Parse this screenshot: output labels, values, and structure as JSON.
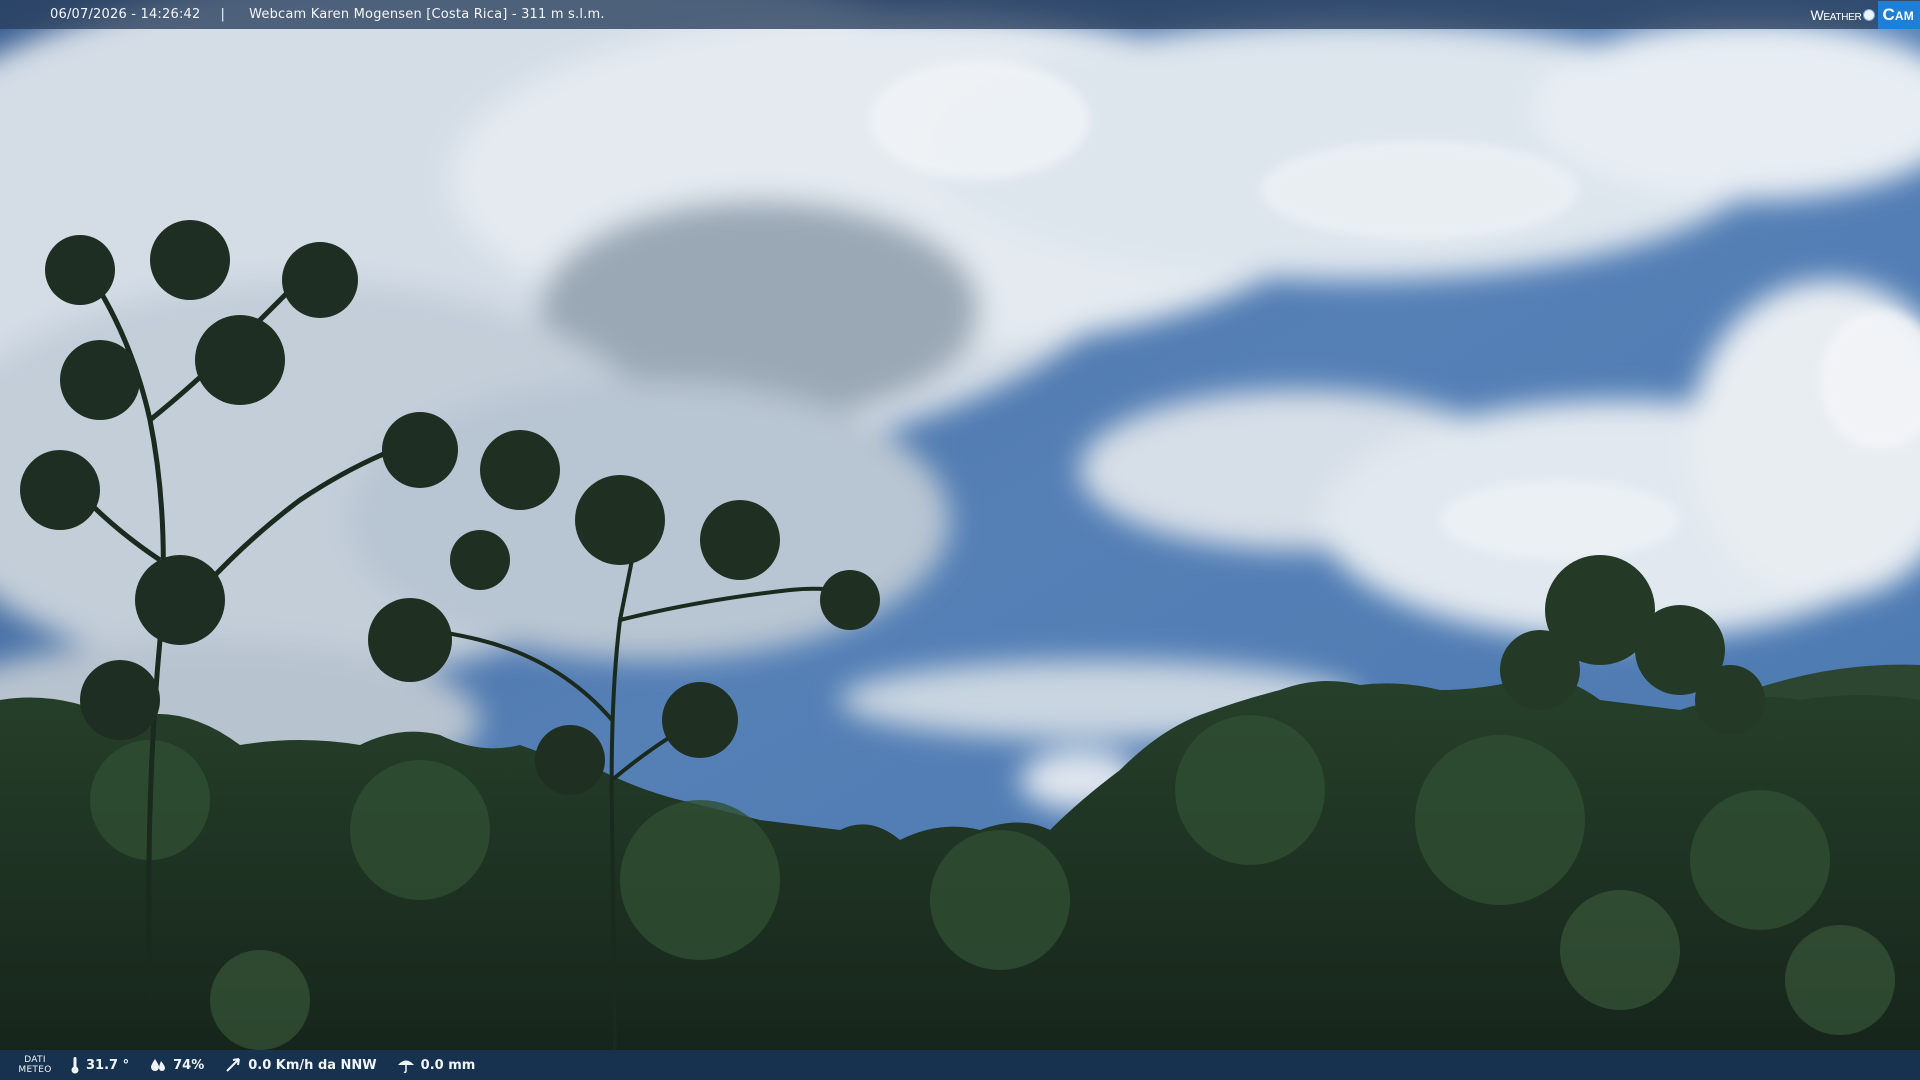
{
  "overlay": {
    "datetime": "06/07/2026 - 14:26:42",
    "separator": "|",
    "title": "Webcam Karen Mogensen [Costa Rica]  - 311 m s.l.m.",
    "brand_weather": "Weather",
    "brand_cam": "Cam"
  },
  "meteo": {
    "label_line1": "DATI",
    "label_line2": "METEO",
    "temperature": "31.7 °",
    "humidity": "74%",
    "wind": "0.0 Km/h da NNW",
    "rain": "0.0 mm"
  },
  "colors": {
    "sky_top": "#3f6fae",
    "sky_mid": "#5b85bb",
    "cloud": "#e8edf2",
    "forest_dark": "#1b2b1d",
    "forest_mid": "#2d4a2c",
    "bar_bottom": "#183456",
    "brand_blue": "#1f7fd6"
  }
}
